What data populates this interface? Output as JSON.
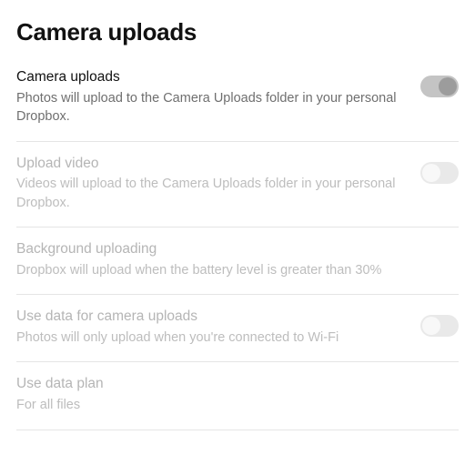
{
  "page": {
    "title": "Camera uploads"
  },
  "settings": [
    {
      "title": "Camera uploads",
      "desc": "Photos will upload to the Camera Uploads folder in your personal Dropbox.",
      "enabled": true,
      "toggle_on": true,
      "has_toggle": true
    },
    {
      "title": "Upload video",
      "desc": "Videos will upload to the Camera Uploads folder in your personal Dropbox.",
      "enabled": false,
      "toggle_on": false,
      "has_toggle": true
    },
    {
      "title": "Background uploading",
      "desc": "Dropbox will upload when the battery level is greater than 30%",
      "enabled": false,
      "toggle_on": false,
      "has_toggle": false
    },
    {
      "title": "Use data for camera uploads",
      "desc": "Photos will only upload when you're connected to Wi-Fi",
      "enabled": false,
      "toggle_on": false,
      "has_toggle": true
    },
    {
      "title": "Use data plan",
      "desc": "For all files",
      "enabled": false,
      "toggle_on": false,
      "has_toggle": false
    }
  ]
}
